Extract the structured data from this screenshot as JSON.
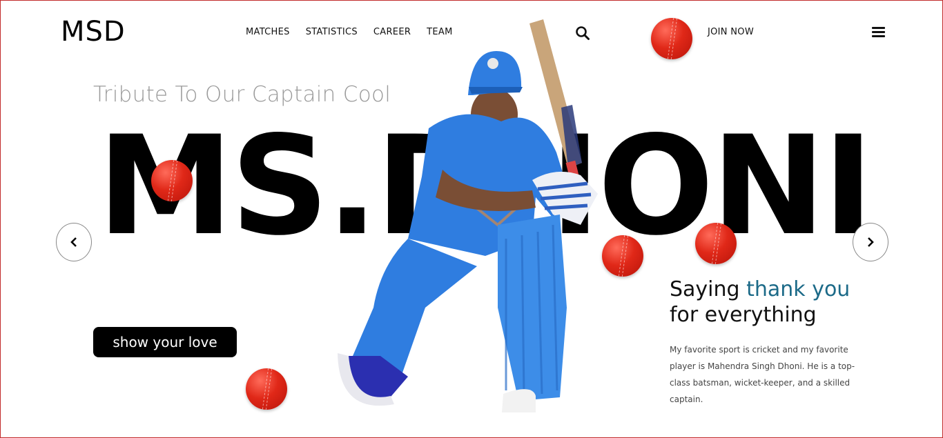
{
  "brand": {
    "logo": "MSD"
  },
  "nav": {
    "items": [
      "MATCHES",
      "STATISTICS",
      "CAREER",
      "TEAM"
    ]
  },
  "header": {
    "search_icon": "search-icon",
    "join_label": "JOIN NOW",
    "menu_icon": "hamburger-menu-icon"
  },
  "hero": {
    "tagline": "Tribute To Our Captain Cool",
    "name": "MS.DHONI",
    "cta_label": "show your love",
    "prev_icon": "chevron-left-icon",
    "next_icon": "chevron-right-icon"
  },
  "side": {
    "saying_prefix": "Saying ",
    "saying_accent": "thank you",
    "saying_line2": "for everything",
    "description": "My favorite sport is cricket and my favorite player is Mahendra Singh Dhoni. He is a top-class batsman, wicket-keeper, and a skilled captain."
  },
  "colors": {
    "accent": "#1c6a88",
    "ball": "#e02818",
    "jersey": "#2f7de0",
    "cta_bg": "#000000"
  }
}
